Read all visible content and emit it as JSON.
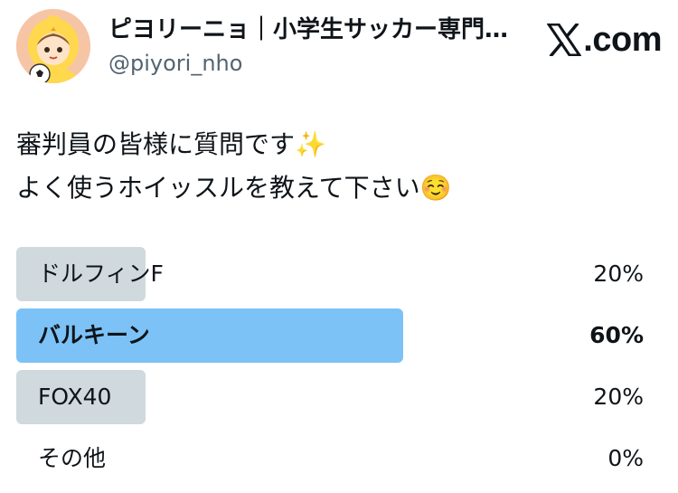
{
  "header": {
    "display_name": "ピヨリーニョ｜小学生サッカー専門…",
    "handle": "@piyori_nho",
    "brand_icon": "x-logo-icon",
    "brand_text": ".com"
  },
  "tweet": {
    "line1": "審判員の皆様に質問です✨",
    "line2": "よく使うホイッスルを教えて下さい☺️"
  },
  "poll": {
    "options": [
      {
        "label": "ドルフィンF",
        "percent": "20%",
        "value": 0.2,
        "winner": false
      },
      {
        "label": "バルキーン",
        "percent": "60%",
        "value": 0.6,
        "winner": true
      },
      {
        "label": "FOX40",
        "percent": "20%",
        "value": 0.2,
        "winner": false
      },
      {
        "label": "その他",
        "percent": "0%",
        "value": 0.0,
        "winner": false
      }
    ]
  },
  "colors": {
    "winner_bar": "#7cc2f6",
    "other_bar": "#cfd9de",
    "handle_text": "#536471"
  }
}
